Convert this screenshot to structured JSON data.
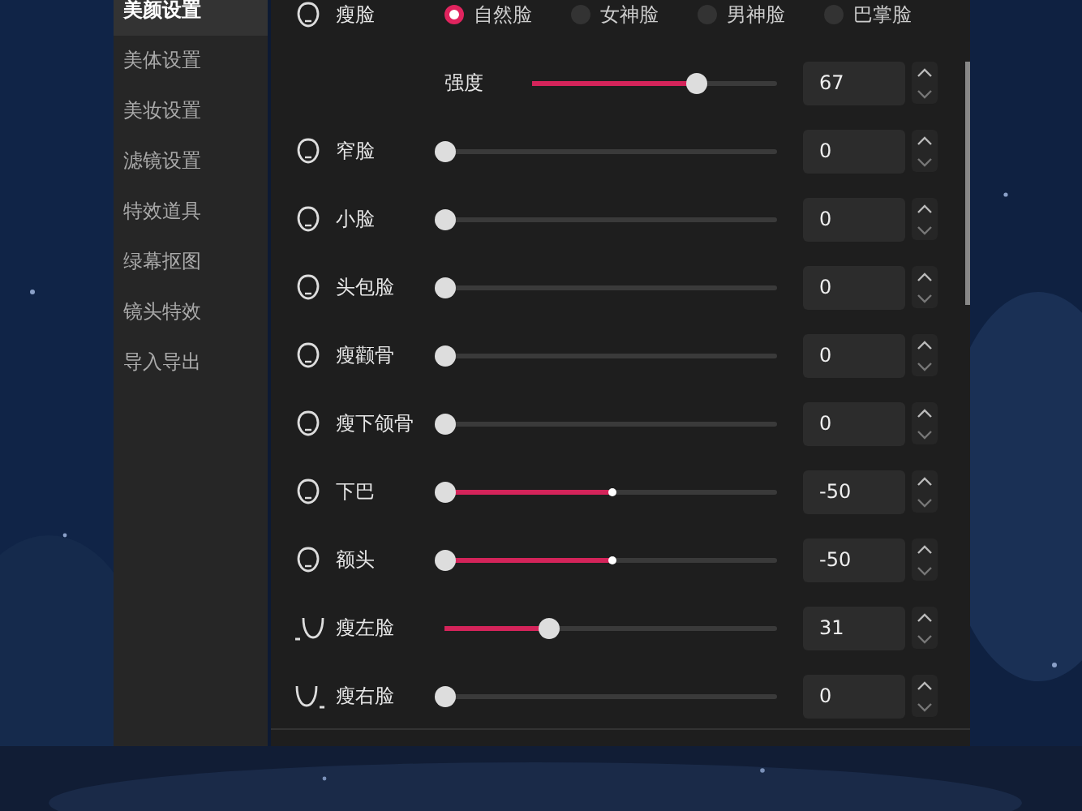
{
  "sidebar": {
    "items": [
      {
        "label": "美颜设置",
        "selected": true
      },
      {
        "label": "美体设置",
        "selected": false
      },
      {
        "label": "美妆设置",
        "selected": false
      },
      {
        "label": "滤镜设置",
        "selected": false
      },
      {
        "label": "特效道具",
        "selected": false
      },
      {
        "label": "绿幕抠图",
        "selected": false
      },
      {
        "label": "镜头特效",
        "selected": false
      },
      {
        "label": "导入导出",
        "selected": false
      }
    ]
  },
  "face_shape": {
    "label": "瘦脸",
    "options": [
      {
        "label": "自然脸",
        "selected": true
      },
      {
        "label": "女神脸",
        "selected": false
      },
      {
        "label": "男神脸",
        "selected": false
      },
      {
        "label": "巴掌脸",
        "selected": false
      }
    ]
  },
  "intensity": {
    "label": "强度",
    "kind": "plain",
    "level": 0.67,
    "value": "67"
  },
  "sliders": [
    {
      "label": "窄脸",
      "kind": "plain",
      "level": 0,
      "value": "0"
    },
    {
      "label": "小脸",
      "kind": "plain",
      "level": 0,
      "value": "0"
    },
    {
      "label": "头包脸",
      "kind": "plain",
      "level": 0,
      "value": "0"
    },
    {
      "label": "瘦颧骨",
      "kind": "plain",
      "level": 0,
      "value": "0"
    },
    {
      "label": "瘦下颌骨",
      "kind": "plain",
      "level": 0,
      "value": "0"
    },
    {
      "label": "下巴",
      "kind": "centered",
      "level": 0,
      "value": "-50"
    },
    {
      "label": "额头",
      "kind": "centered",
      "level": 0,
      "value": "-50"
    },
    {
      "label": "瘦左脸",
      "kind": "plain",
      "level": 0.31,
      "value": "31"
    },
    {
      "label": "瘦右脸",
      "kind": "plain",
      "level": 0,
      "value": "0"
    }
  ]
}
